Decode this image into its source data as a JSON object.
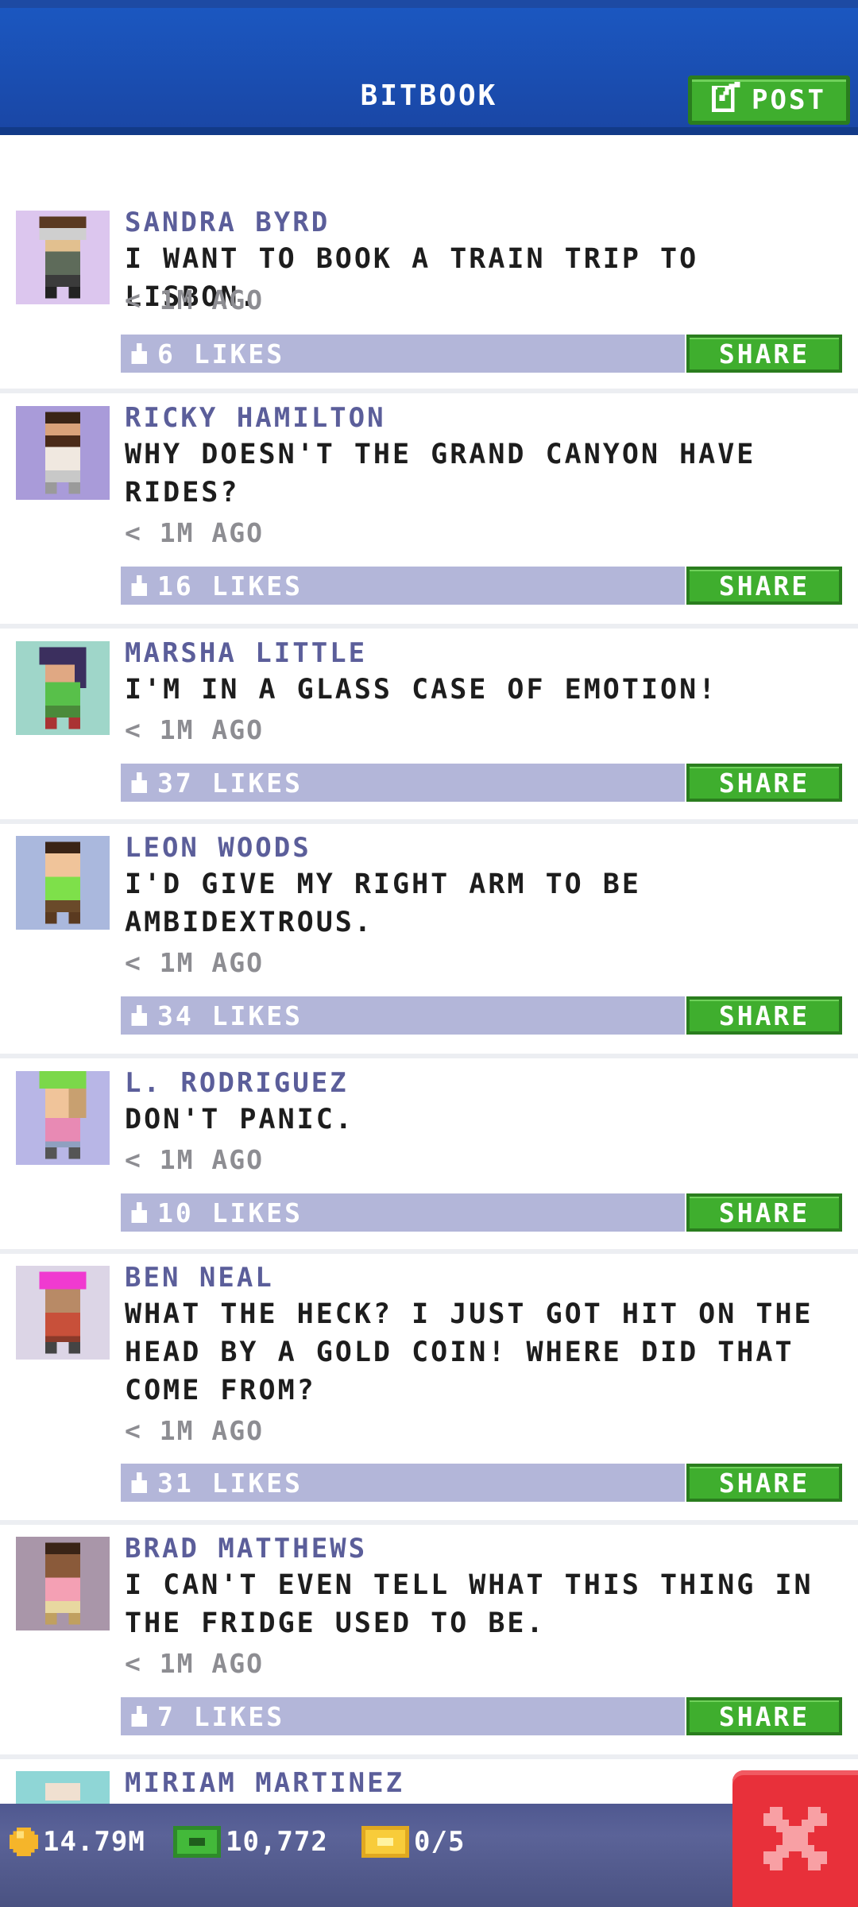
{
  "header": {
    "title": "BITBOOK",
    "post_label": "POST"
  },
  "posts": [
    {
      "author": "SANDRA BYRD",
      "text": "I WANT TO BOOK A TRAIN TRIP TO LISBON.",
      "time": "< 1M AGO",
      "likes": "6 LIKES",
      "share": "SHARE",
      "avatar_bg": "#dcc6ee"
    },
    {
      "author": "RICKY HAMILTON",
      "text": "WHY DOESN'T THE GRAND CANYON HAVE RIDES?",
      "time": "< 1M AGO",
      "likes": "16 LIKES",
      "share": "SHARE",
      "avatar_bg": "#a99bd9"
    },
    {
      "author": "MARSHA LITTLE",
      "text": "I'M IN A GLASS CASE OF EMOTION!",
      "time": "< 1M AGO",
      "likes": "37 LIKES",
      "share": "SHARE",
      "avatar_bg": "#9fd6c9"
    },
    {
      "author": "LEON WOODS",
      "text": "I'D GIVE MY RIGHT ARM TO BE AMBIDEXTROUS.",
      "time": "< 1M AGO",
      "likes": "34 LIKES",
      "share": "SHARE",
      "avatar_bg": "#aab8dd"
    },
    {
      "author": "L. RODRIGUEZ",
      "text": "DON'T PANIC.",
      "time": "< 1M AGO",
      "likes": "10 LIKES",
      "share": "SHARE",
      "avatar_bg": "#b8b6e6"
    },
    {
      "author": "BEN NEAL",
      "text": "WHAT THE HECK? I JUST GOT HIT ON THE HEAD BY A GOLD COIN! WHERE DID THAT COME FROM?",
      "time": "< 1M AGO",
      "likes": "31 LIKES",
      "share": "SHARE",
      "avatar_bg": "#dcd5e6"
    },
    {
      "author": "BRAD MATTHEWS",
      "text": "I CAN'T EVEN TELL WHAT THIS THING IN THE FRIDGE USED TO BE.",
      "time": "< 1M AGO",
      "likes": "7 LIKES",
      "share": "SHARE",
      "avatar_bg": "#a996a9"
    },
    {
      "author": "MIRIAM MARTINEZ",
      "text": "",
      "time": "",
      "likes": "",
      "share": "",
      "avatar_bg": "#8fd6d6"
    }
  ],
  "bottom_bar": {
    "coins": "14.79M",
    "bux": "10,772",
    "tickets": "0/5"
  },
  "colors": {
    "header_blue": "#1a47a6",
    "accent_green": "#3fae2e",
    "close_red": "#e8303a",
    "likes_bar": "#b3b6d9"
  }
}
